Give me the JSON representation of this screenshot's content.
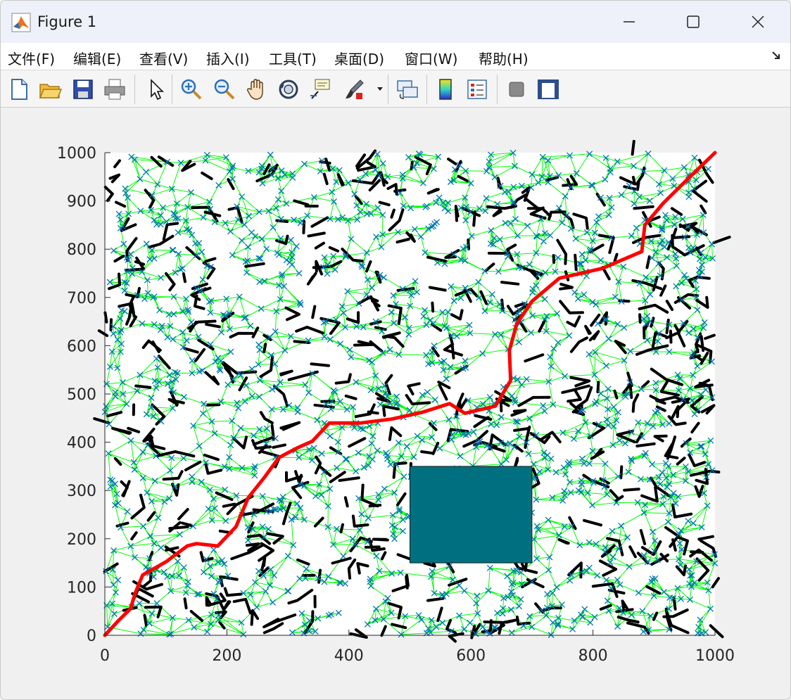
{
  "window": {
    "title": "Figure 1",
    "icon": "matlab-icon"
  },
  "menu": [
    {
      "label": "文件(F)",
      "x": 10
    },
    {
      "label": "编辑(E)",
      "x": 103
    },
    {
      "label": "查看(V)",
      "x": 197
    },
    {
      "label": "插入(I)",
      "x": 292
    },
    {
      "label": "工具(T)",
      "x": 381
    },
    {
      "label": "桌面(D)",
      "x": 474
    },
    {
      "label": "窗口(W)",
      "x": 574
    },
    {
      "label": "帮助(H)",
      "x": 679
    }
  ],
  "toolbar": [
    "new-figure-icon",
    "open-file-icon",
    "save-icon",
    "print-icon",
    "edit-plot-arrow-icon",
    "zoom-in-icon",
    "zoom-out-icon",
    "pan-hand-icon",
    "rotate-3d-icon",
    "data-cursor-icon",
    "brush-icon",
    "link-plot-icon",
    "colorbar-icon",
    "legend-icon",
    "hide-plot-tools-icon",
    "show-plot-tools-icon"
  ],
  "chart_data": {
    "type": "scatter",
    "description_series": [
      {
        "name": "samples",
        "marker": "x",
        "color": "#0072bd",
        "count": 1400
      },
      {
        "name": "roadmap-edges",
        "color": "#00ff00"
      },
      {
        "name": "tree-segments",
        "color": "#000000"
      },
      {
        "name": "path",
        "color": "#ff0000"
      }
    ],
    "xlim": [
      0,
      1000
    ],
    "ylim": [
      0,
      1000
    ],
    "xticks": [
      0,
      200,
      400,
      600,
      800,
      1000
    ],
    "yticks": [
      0,
      100,
      200,
      300,
      400,
      500,
      600,
      700,
      800,
      900,
      1000
    ],
    "obstacle": {
      "x0": 500,
      "y0": 150,
      "x1": 700,
      "y1": 350,
      "color": "#007080"
    },
    "path": [
      [
        0,
        0
      ],
      [
        22,
        30
      ],
      [
        42,
        55
      ],
      [
        50,
        88
      ],
      [
        62,
        125
      ],
      [
        100,
        152
      ],
      [
        135,
        185
      ],
      [
        150,
        190
      ],
      [
        185,
        185
      ],
      [
        215,
        225
      ],
      [
        235,
        285
      ],
      [
        262,
        328
      ],
      [
        285,
        368
      ],
      [
        315,
        388
      ],
      [
        340,
        402
      ],
      [
        368,
        440
      ],
      [
        420,
        440
      ],
      [
        470,
        448
      ],
      [
        520,
        462
      ],
      [
        565,
        480
      ],
      [
        590,
        460
      ],
      [
        640,
        475
      ],
      [
        665,
        528
      ],
      [
        663,
        590
      ],
      [
        675,
        645
      ],
      [
        700,
        692
      ],
      [
        745,
        740
      ],
      [
        815,
        760
      ],
      [
        880,
        795
      ],
      [
        885,
        850
      ],
      [
        915,
        895
      ],
      [
        955,
        945
      ],
      [
        1000,
        1000
      ]
    ]
  }
}
